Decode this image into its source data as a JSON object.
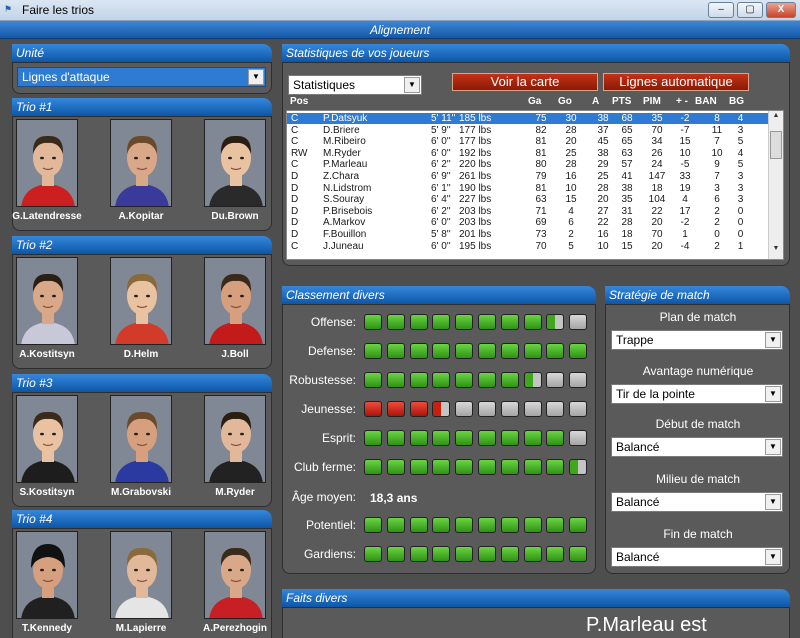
{
  "window": {
    "title": "Faire les trios",
    "icon": "app-icon",
    "buttons": [
      "–",
      "▢",
      "X"
    ]
  },
  "header": {
    "title": "Alignement"
  },
  "unit": {
    "title": "Unité",
    "selected": "Lignes d'attaque"
  },
  "trios": [
    {
      "title": "Trio #1",
      "players": [
        "G.Latendresse",
        "A.Kopitar",
        "Du.Brown"
      ]
    },
    {
      "title": "Trio #2",
      "players": [
        "A.Kostitsyn",
        "D.Helm",
        "J.Boll"
      ]
    },
    {
      "title": "Trio #3",
      "players": [
        "S.Kostitsyn",
        "M.Grabovski",
        "M.Ryder"
      ]
    },
    {
      "title": "Trio #4",
      "players": [
        "T.Kennedy",
        "M.Lapierre",
        "A.Perezhogin"
      ]
    }
  ],
  "stats": {
    "title": "Statistiques de vos joueurs",
    "dropdown": "Statistiques",
    "btn_card": "Voir la carte",
    "btn_auto": "Lignes automatique",
    "columns": [
      "Pos",
      "Ga",
      "Go",
      "A",
      "PTS",
      "PIM",
      "+ -",
      "BAN",
      "BG"
    ],
    "rows": [
      [
        "C",
        "P.Datsyuk",
        "5' 11''",
        "185 lbs",
        "75",
        "30",
        "38",
        "68",
        "35",
        "-2",
        "8",
        "4"
      ],
      [
        "C",
        "D.Briere",
        "5' 9''",
        "177 lbs",
        "82",
        "28",
        "37",
        "65",
        "70",
        "-7",
        "11",
        "3"
      ],
      [
        "C",
        "M.Ribeiro",
        "6' 0''",
        "177 lbs",
        "81",
        "20",
        "45",
        "65",
        "34",
        "15",
        "7",
        "5"
      ],
      [
        "RW",
        "M.Ryder",
        "6' 0''",
        "192 lbs",
        "81",
        "25",
        "38",
        "63",
        "26",
        "10",
        "10",
        "4"
      ],
      [
        "C",
        "P.Marleau",
        "6' 2''",
        "220 lbs",
        "80",
        "28",
        "29",
        "57",
        "24",
        "-5",
        "9",
        "5"
      ],
      [
        "D",
        "Z.Chara",
        "6' 9''",
        "261 lbs",
        "79",
        "16",
        "25",
        "41",
        "147",
        "33",
        "7",
        "3"
      ],
      [
        "D",
        "N.Lidstrom",
        "6' 1''",
        "190 lbs",
        "81",
        "10",
        "28",
        "38",
        "18",
        "19",
        "3",
        "3"
      ],
      [
        "D",
        "S.Souray",
        "6' 4''",
        "227 lbs",
        "63",
        "15",
        "20",
        "35",
        "104",
        "4",
        "6",
        "3"
      ],
      [
        "D",
        "P.Brisebois",
        "6' 2''",
        "203 lbs",
        "71",
        "4",
        "27",
        "31",
        "22",
        "17",
        "2",
        "0"
      ],
      [
        "D",
        "A.Markov",
        "6' 0''",
        "203 lbs",
        "69",
        "6",
        "22",
        "28",
        "20",
        "-2",
        "2",
        "0"
      ],
      [
        "D",
        "F.Bouillon",
        "5' 8''",
        "201 lbs",
        "73",
        "2",
        "16",
        "18",
        "70",
        "1",
        "0",
        "0"
      ],
      [
        "C",
        "J.Juneau",
        "6' 0''",
        "195 lbs",
        "70",
        "5",
        "10",
        "15",
        "20",
        "-4",
        "2",
        "1"
      ]
    ]
  },
  "classement": {
    "title": "Classement divers",
    "ratings": [
      {
        "label": "Offense:",
        "level": 0.85
      },
      {
        "label": "Defense:",
        "level": 1.0
      },
      {
        "label": "Robustesse:",
        "level": 0.75
      },
      {
        "label": "Jeunesse:",
        "level": 0.35
      },
      {
        "label": "Esprit:",
        "level": 0.9
      },
      {
        "label": "Club ferme:",
        "level": 0.95
      }
    ],
    "age_label": "Âge moyen:",
    "age_value": "18,3 ans",
    "ratings2": [
      {
        "label": "Potentiel:",
        "level": 1.0
      },
      {
        "label": "Gardiens:",
        "level": 1.0
      }
    ]
  },
  "strategie": {
    "title": "Stratégie de match",
    "items": [
      {
        "label": "Plan de match",
        "value": "Trappe"
      },
      {
        "label": "Avantage numérique",
        "value": "Tir de la pointe"
      },
      {
        "label": "Début de match",
        "value": "Balancé"
      },
      {
        "label": "Milieu de match",
        "value": "Balancé"
      },
      {
        "label": "Fin de match",
        "value": "Balancé"
      }
    ]
  },
  "faits": {
    "title": "Faits divers",
    "text": "P.Marleau est"
  },
  "colors": {
    "accent": "#1566b8",
    "green": "#3cae1c",
    "red": "#d42514",
    "gray": "#bdbdbd"
  }
}
